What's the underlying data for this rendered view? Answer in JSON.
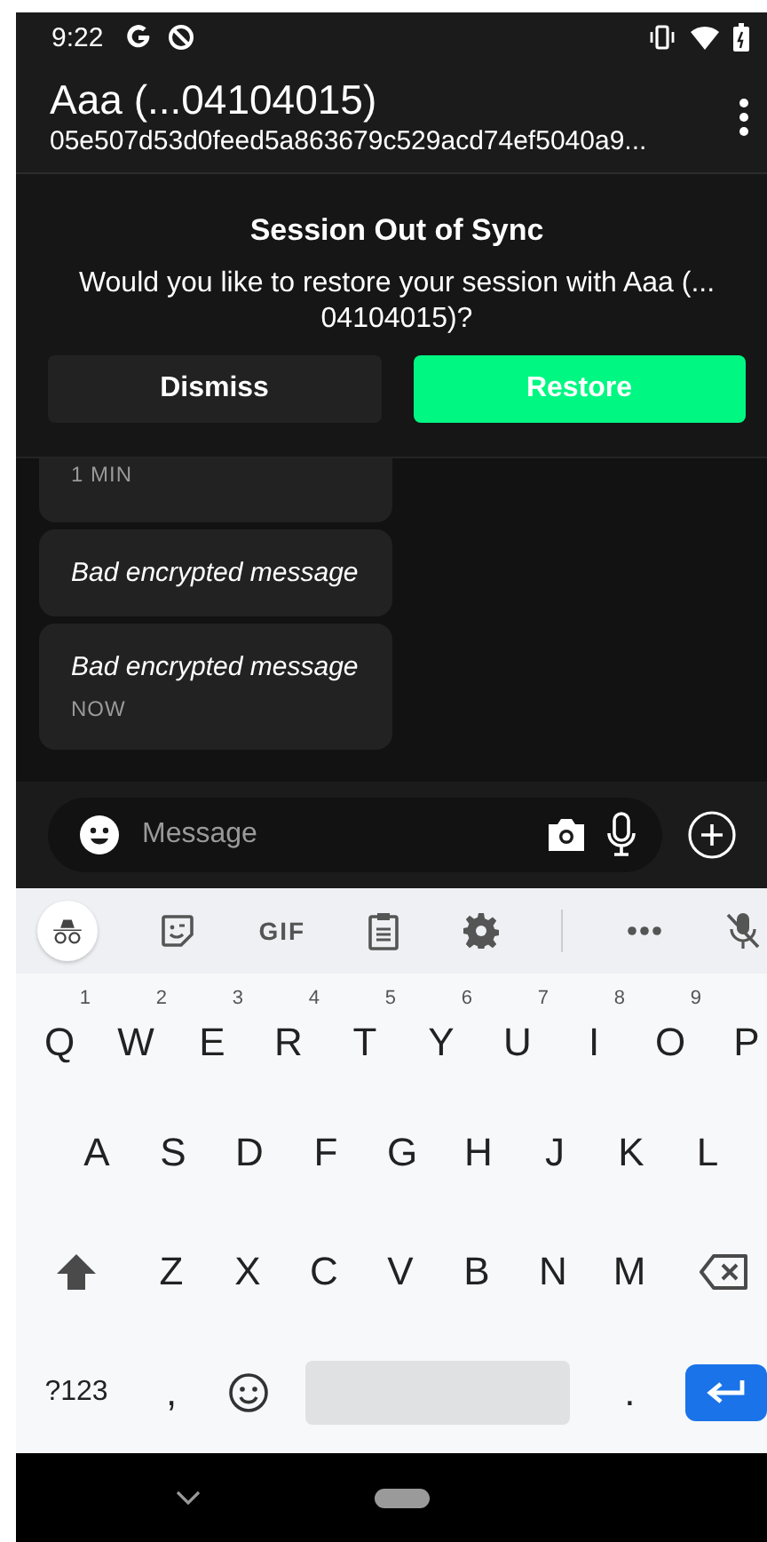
{
  "status_bar": {
    "time": "9:22"
  },
  "header": {
    "title": "Aaa (...04104015)",
    "subtitle": "05e507d53d0feed5a863679c529acd74ef5040a9..."
  },
  "banner": {
    "title": "Session Out of Sync",
    "text": "Would you like to restore your session with Aaa (... 04104015)?",
    "buttons": [
      {
        "label": "Dismiss",
        "kind": "secondary"
      },
      {
        "label": "Restore",
        "kind": "primary"
      }
    ]
  },
  "messages": [
    {
      "time": "1 MIN"
    },
    {
      "text": "Bad encrypted message"
    },
    {
      "text": "Bad encrypted message",
      "time": "NOW"
    }
  ],
  "composer": {
    "placeholder": "Message"
  },
  "keyboard": {
    "toolbar": [
      {
        "kind": "incognito"
      },
      {
        "kind": "sticker"
      },
      {
        "kind": "gif",
        "label": "GIF"
      },
      {
        "kind": "clipboard"
      },
      {
        "kind": "settings"
      },
      {
        "kind": "divider"
      },
      {
        "kind": "more"
      },
      {
        "kind": "mic-off"
      }
    ],
    "rows": [
      [
        {
          "kind": "letter",
          "label": "Q",
          "hint": "1"
        },
        {
          "kind": "letter",
          "label": "W",
          "hint": "2"
        },
        {
          "kind": "letter",
          "label": "E",
          "hint": "3"
        },
        {
          "kind": "letter",
          "label": "R",
          "hint": "4"
        },
        {
          "kind": "letter",
          "label": "T",
          "hint": "5"
        },
        {
          "kind": "letter",
          "label": "Y",
          "hint": "6"
        },
        {
          "kind": "letter",
          "label": "U",
          "hint": "7"
        },
        {
          "kind": "letter",
          "label": "I",
          "hint": "8"
        },
        {
          "kind": "letter",
          "label": "O",
          "hint": "9"
        },
        {
          "kind": "letter",
          "label": "P"
        }
      ],
      [
        {
          "kind": "letter",
          "label": "A"
        },
        {
          "kind": "letter",
          "label": "S"
        },
        {
          "kind": "letter",
          "label": "D"
        },
        {
          "kind": "letter",
          "label": "F"
        },
        {
          "kind": "letter",
          "label": "G"
        },
        {
          "kind": "letter",
          "label": "H"
        },
        {
          "kind": "letter",
          "label": "J"
        },
        {
          "kind": "letter",
          "label": "K"
        },
        {
          "kind": "letter",
          "label": "L"
        }
      ],
      [
        {
          "kind": "shift"
        },
        {
          "kind": "letter",
          "label": "Z"
        },
        {
          "kind": "letter",
          "label": "X"
        },
        {
          "kind": "letter",
          "label": "C"
        },
        {
          "kind": "letter",
          "label": "V"
        },
        {
          "kind": "letter",
          "label": "B"
        },
        {
          "kind": "letter",
          "label": "N"
        },
        {
          "kind": "letter",
          "label": "M"
        },
        {
          "kind": "backspace"
        }
      ]
    ],
    "bottom_row": [
      {
        "kind": "symbols",
        "label": "?123"
      },
      {
        "kind": "letter",
        "label": ","
      },
      {
        "kind": "emoji"
      },
      {
        "kind": "space"
      },
      {
        "kind": "letter",
        "label": "."
      },
      {
        "kind": "enter"
      }
    ]
  }
}
